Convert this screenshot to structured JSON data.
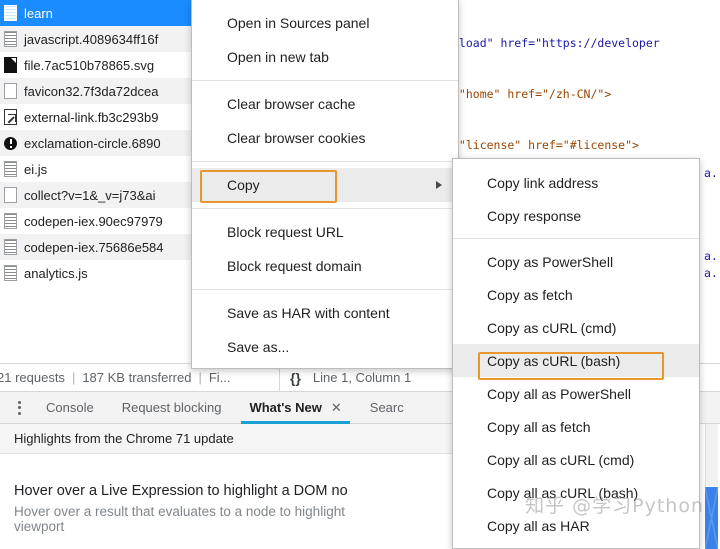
{
  "colors": {
    "selection_blue": "#1a8cff",
    "highlight_orange": "#e8962f",
    "tab_underline": "#1a9fd4",
    "scrollbar_blue": "#3b82e8",
    "menu_hover": "#ebebeb"
  },
  "code_panel": {
    "lines": [
      "eload\" href=\"https://developer",
      "=\"home\" href=\"/zh-CN/\">",
      "=\"license\" href=\"#license\">"
    ],
    "right_fragments": [
      "a.",
      "a.",
      "a."
    ]
  },
  "network_files": {
    "rows": [
      {
        "name": "learn",
        "icon": "script-file-icon",
        "selected": true
      },
      {
        "name": "javascript.4089634ff16f",
        "icon": "script-file-icon",
        "selected": false
      },
      {
        "name": "file.7ac510b78865.svg",
        "icon": "image-file-icon",
        "selected": false
      },
      {
        "name": "favicon32.7f3da72dcea",
        "icon": "document-file-icon",
        "selected": false
      },
      {
        "name": "external-link.fb3c293b9",
        "icon": "external-link-file-icon",
        "selected": false
      },
      {
        "name": "exclamation-circle.6890",
        "icon": "exclamation-circle-icon",
        "selected": false
      },
      {
        "name": "ei.js",
        "icon": "script-file-icon",
        "selected": false
      },
      {
        "name": "collect?v=1&_v=j73&ai",
        "icon": "document-file-icon",
        "selected": false
      },
      {
        "name": "codepen-iex.90ec97979",
        "icon": "script-file-icon",
        "selected": false
      },
      {
        "name": "codepen-iex.75686e584",
        "icon": "script-file-icon",
        "selected": false
      },
      {
        "name": "analytics.js",
        "icon": "script-file-icon",
        "selected": false
      }
    ]
  },
  "status_bar": {
    "requests": "21 requests",
    "transferred": "187 KB transferred",
    "finish": "Fi...",
    "braces_icon": "{}",
    "cursor_position": "Line 1, Column 1"
  },
  "drawer_tabs": {
    "more_icon": "kebab-menu-icon",
    "items": [
      {
        "label": "Console",
        "active": false,
        "closable": false
      },
      {
        "label": "Request blocking",
        "active": false,
        "closable": false
      },
      {
        "label": "What's New",
        "active": true,
        "closable": true,
        "close_icon": "close-icon"
      },
      {
        "label": "Searc",
        "active": false,
        "closable": false
      }
    ]
  },
  "whats_new": {
    "subtitle": "Highlights from the Chrome 71 update",
    "entry_title": "Hover over a Live Expression to highlight a DOM no",
    "entry_desc_line1": "Hover over a result that evaluates to a node to highlight",
    "entry_desc_line2": "viewport"
  },
  "context_menu": {
    "items": [
      {
        "label": "Open in Sources panel",
        "type": "item",
        "highlighted": false,
        "submenu": false
      },
      {
        "label": "Open in new tab",
        "type": "item",
        "highlighted": false,
        "submenu": false
      },
      {
        "type": "separator"
      },
      {
        "label": "Clear browser cache",
        "type": "item",
        "highlighted": false,
        "submenu": false
      },
      {
        "label": "Clear browser cookies",
        "type": "item",
        "highlighted": false,
        "submenu": false
      },
      {
        "type": "separator"
      },
      {
        "label": "Copy",
        "type": "item",
        "highlighted": true,
        "submenu": true,
        "arrow_icon": "chevron-right-icon"
      },
      {
        "type": "separator"
      },
      {
        "label": "Block request URL",
        "type": "item",
        "highlighted": false,
        "submenu": false
      },
      {
        "label": "Block request domain",
        "type": "item",
        "highlighted": false,
        "submenu": false
      },
      {
        "type": "separator"
      },
      {
        "label": "Save as HAR with content",
        "type": "item",
        "highlighted": false,
        "submenu": false
      },
      {
        "label": "Save as...",
        "type": "item",
        "highlighted": false,
        "submenu": false
      }
    ]
  },
  "copy_submenu": {
    "items": [
      {
        "label": "Copy link address",
        "type": "item",
        "highlighted": false
      },
      {
        "label": "Copy response",
        "type": "item",
        "highlighted": false
      },
      {
        "type": "separator"
      },
      {
        "label": "Copy as PowerShell",
        "type": "item",
        "highlighted": false
      },
      {
        "label": "Copy as fetch",
        "type": "item",
        "highlighted": false
      },
      {
        "label": "Copy as cURL (cmd)",
        "type": "item",
        "highlighted": false
      },
      {
        "label": "Copy as cURL (bash)",
        "type": "item",
        "highlighted": true
      },
      {
        "label": "Copy all as PowerShell",
        "type": "item",
        "highlighted": false
      },
      {
        "label": "Copy all as fetch",
        "type": "item",
        "highlighted": false
      },
      {
        "label": "Copy all as cURL (cmd)",
        "type": "item",
        "highlighted": false
      },
      {
        "label": "Copy all as cURL (bash)",
        "type": "item",
        "highlighted": false
      },
      {
        "label": "Copy all as HAR",
        "type": "item",
        "highlighted": false
      }
    ]
  },
  "watermark": {
    "text": "知乎 @学习Python"
  }
}
